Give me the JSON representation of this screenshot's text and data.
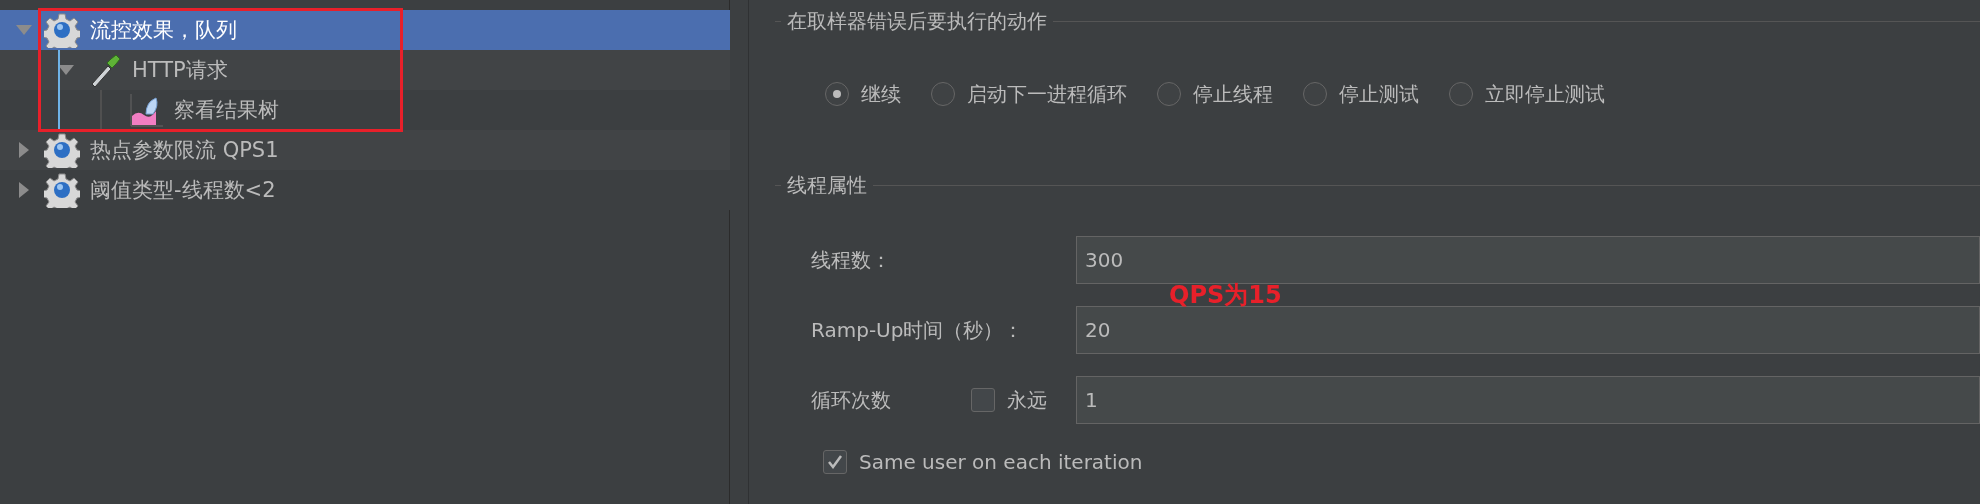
{
  "tree": [
    {
      "label": "流控效果，队列",
      "kind": "gear",
      "expanded": true,
      "selected": true,
      "children": [
        {
          "label": "HTTP请求",
          "kind": "pipette",
          "expanded": true,
          "selected": false,
          "children": [
            {
              "label": "察看结果树",
              "kind": "chart",
              "selected": false
            }
          ]
        }
      ]
    },
    {
      "label": "热点参数限流 QPS1",
      "kind": "gear",
      "expanded": false,
      "selected": false
    },
    {
      "label": "阈值类型-线程数<2",
      "kind": "gear",
      "expanded": false,
      "selected": false
    }
  ],
  "on_sampler_error": {
    "title": "在取样器错误后要执行的动作",
    "options": [
      {
        "label": "继续",
        "selected": true
      },
      {
        "label": "启动下一进程循环",
        "selected": false
      },
      {
        "label": "停止线程",
        "selected": false
      },
      {
        "label": "停止测试",
        "selected": false
      },
      {
        "label": "立即停止测试",
        "selected": false
      }
    ]
  },
  "thread_properties": {
    "title": "线程属性",
    "threads": {
      "label": "线程数：",
      "value": "300"
    },
    "ramp_up": {
      "label": "Ramp-Up时间（秒）：",
      "value": "20"
    },
    "loop": {
      "label": "循环次数",
      "forever": {
        "label": "永远",
        "checked": false
      },
      "value": "1"
    },
    "same_user": {
      "label": "Same user on each iteration",
      "checked": true
    }
  },
  "annotation": {
    "text": "QPS为15"
  }
}
